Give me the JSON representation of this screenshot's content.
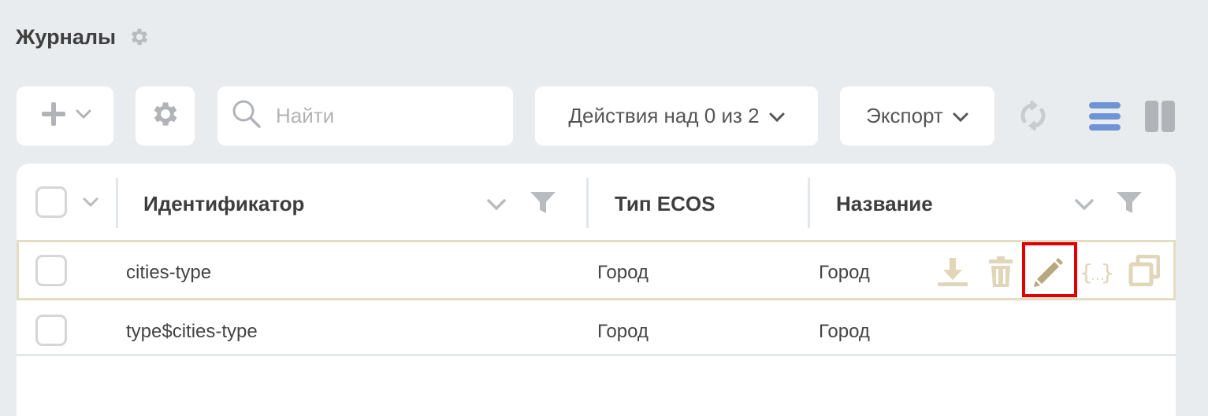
{
  "header": {
    "title": "Журналы",
    "settings_icon": "gear-icon"
  },
  "toolbar": {
    "add_icon": "plus-icon",
    "search_placeholder": "Найти",
    "actions_label": "Действия над 0 из 2",
    "export_label": "Экспорт",
    "icons": [
      "refresh-icon",
      "list-view-icon",
      "grid-view-icon"
    ]
  },
  "table": {
    "columns": [
      {
        "label": "Идентификатор"
      },
      {
        "label": "Тип ECOS"
      },
      {
        "label": "Название"
      }
    ],
    "rows": [
      {
        "id": "cities-type",
        "type": "Город",
        "name": "Город"
      },
      {
        "id": "type$cities-type",
        "type": "Город",
        "name": "Город"
      }
    ],
    "row_actions": [
      "download-icon",
      "delete-icon",
      "edit-icon",
      "json-icon",
      "copy-icon"
    ]
  },
  "colors": {
    "background": "#e8ecef",
    "accent_blue": "#6f94d6",
    "action_icon": "#e0d6b8",
    "edit_icon": "#b8a880",
    "highlight": "#e00000"
  }
}
